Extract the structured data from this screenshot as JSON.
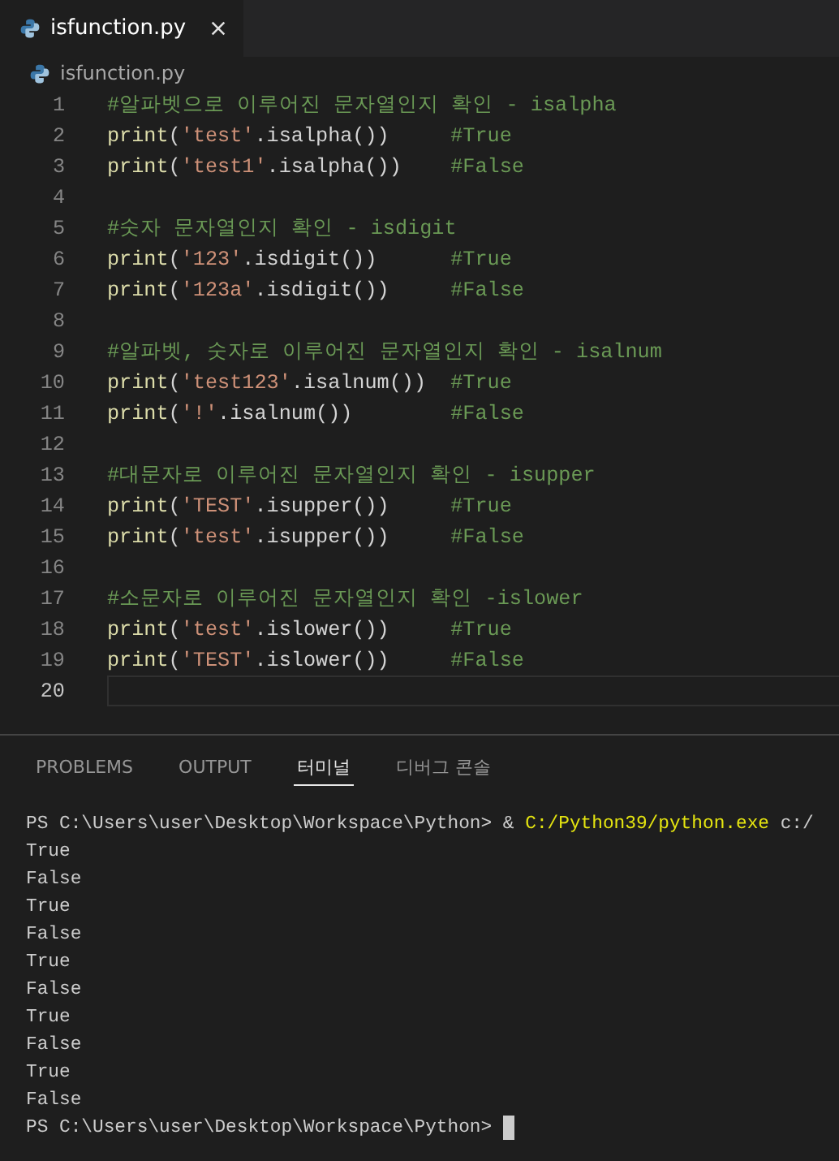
{
  "editor_tabs": [
    {
      "label": "isfunction.py",
      "selected": true
    }
  ],
  "breadcrumb": {
    "file": "isfunction.py"
  },
  "code": {
    "lines": [
      {
        "number": "1",
        "current": false,
        "tokens": [
          {
            "kind": "comment",
            "text": "#알파벳으로 이루어진 문자열인지 확인 - isalpha"
          }
        ]
      },
      {
        "number": "2",
        "current": false,
        "tokens": [
          {
            "kind": "func",
            "text": "print"
          },
          {
            "kind": "plain",
            "text": "("
          },
          {
            "kind": "string",
            "text": "'test'"
          },
          {
            "kind": "plain",
            "text": ".isalpha())"
          }
        ],
        "comment": "#True"
      },
      {
        "number": "3",
        "current": false,
        "tokens": [
          {
            "kind": "func",
            "text": "print"
          },
          {
            "kind": "plain",
            "text": "("
          },
          {
            "kind": "string",
            "text": "'test1'"
          },
          {
            "kind": "plain",
            "text": ".isalpha())"
          }
        ],
        "comment": "#False"
      },
      {
        "number": "4",
        "current": false
      },
      {
        "number": "5",
        "current": false,
        "tokens": [
          {
            "kind": "comment",
            "text": "#숫자 문자열인지 확인 - isdigit"
          }
        ]
      },
      {
        "number": "6",
        "current": false,
        "tokens": [
          {
            "kind": "func",
            "text": "print"
          },
          {
            "kind": "plain",
            "text": "("
          },
          {
            "kind": "string",
            "text": "'123'"
          },
          {
            "kind": "plain",
            "text": ".isdigit())"
          }
        ],
        "comment": "#True"
      },
      {
        "number": "7",
        "current": false,
        "tokens": [
          {
            "kind": "func",
            "text": "print"
          },
          {
            "kind": "plain",
            "text": "("
          },
          {
            "kind": "string",
            "text": "'123a'"
          },
          {
            "kind": "plain",
            "text": ".isdigit())"
          }
        ],
        "comment": "#False"
      },
      {
        "number": "8",
        "current": false
      },
      {
        "number": "9",
        "current": false,
        "tokens": [
          {
            "kind": "comment",
            "text": "#알파벳, 숫자로 이루어진 문자열인지 확인 - isalnum"
          }
        ]
      },
      {
        "number": "10",
        "current": false,
        "tokens": [
          {
            "kind": "func",
            "text": "print"
          },
          {
            "kind": "plain",
            "text": "("
          },
          {
            "kind": "string",
            "text": "'test123'"
          },
          {
            "kind": "plain",
            "text": ".isalnum())"
          }
        ],
        "comment": "#True"
      },
      {
        "number": "11",
        "current": false,
        "tokens": [
          {
            "kind": "func",
            "text": "print"
          },
          {
            "kind": "plain",
            "text": "("
          },
          {
            "kind": "string",
            "text": "'!'"
          },
          {
            "kind": "plain",
            "text": ".isalnum())"
          }
        ],
        "comment": "#False"
      },
      {
        "number": "12",
        "current": false
      },
      {
        "number": "13",
        "current": false,
        "tokens": [
          {
            "kind": "comment",
            "text": "#대문자로 이루어진 문자열인지 확인 - isupper"
          }
        ]
      },
      {
        "number": "14",
        "current": false,
        "tokens": [
          {
            "kind": "func",
            "text": "print"
          },
          {
            "kind": "plain",
            "text": "("
          },
          {
            "kind": "string",
            "text": "'TEST'"
          },
          {
            "kind": "plain",
            "text": ".isupper())"
          }
        ],
        "comment": "#True"
      },
      {
        "number": "15",
        "current": false,
        "tokens": [
          {
            "kind": "func",
            "text": "print"
          },
          {
            "kind": "plain",
            "text": "("
          },
          {
            "kind": "string",
            "text": "'test'"
          },
          {
            "kind": "plain",
            "text": ".isupper())"
          }
        ],
        "comment": "#False"
      },
      {
        "number": "16",
        "current": false
      },
      {
        "number": "17",
        "current": false,
        "tokens": [
          {
            "kind": "comment",
            "text": "#소문자로 이루어진 문자열인지 확인 -islower"
          }
        ]
      },
      {
        "number": "18",
        "current": false,
        "tokens": [
          {
            "kind": "func",
            "text": "print"
          },
          {
            "kind": "plain",
            "text": "("
          },
          {
            "kind": "string",
            "text": "'test'"
          },
          {
            "kind": "plain",
            "text": ".islower())"
          }
        ],
        "comment": "#True"
      },
      {
        "number": "19",
        "current": false,
        "tokens": [
          {
            "kind": "func",
            "text": "print"
          },
          {
            "kind": "plain",
            "text": "("
          },
          {
            "kind": "string",
            "text": "'TEST'"
          },
          {
            "kind": "plain",
            "text": ".islower())"
          }
        ],
        "comment": "#False"
      },
      {
        "number": "20",
        "current": true
      }
    ]
  },
  "panel_tabs": [
    {
      "label": "PROBLEMS",
      "selected": false
    },
    {
      "label": "OUTPUT",
      "selected": false
    },
    {
      "label": "터미널",
      "selected": true
    },
    {
      "label": "디버그 콘솔",
      "selected": false
    }
  ],
  "terminal": {
    "lines": [
      {
        "segments": [
          {
            "kind": "plain",
            "text": "PS C:\\Users\\user\\Desktop\\Workspace\\Python> & "
          },
          {
            "kind": "exe",
            "text": "C:/Python39/python.exe"
          },
          {
            "kind": "plain",
            "text": " c:/"
          }
        ]
      },
      {
        "segments": [
          {
            "kind": "plain",
            "text": "True"
          }
        ]
      },
      {
        "segments": [
          {
            "kind": "plain",
            "text": "False"
          }
        ]
      },
      {
        "segments": [
          {
            "kind": "plain",
            "text": "True"
          }
        ]
      },
      {
        "segments": [
          {
            "kind": "plain",
            "text": "False"
          }
        ]
      },
      {
        "segments": [
          {
            "kind": "plain",
            "text": "True"
          }
        ]
      },
      {
        "segments": [
          {
            "kind": "plain",
            "text": "False"
          }
        ]
      },
      {
        "segments": [
          {
            "kind": "plain",
            "text": "True"
          }
        ]
      },
      {
        "segments": [
          {
            "kind": "plain",
            "text": "False"
          }
        ]
      },
      {
        "segments": [
          {
            "kind": "plain",
            "text": "True"
          }
        ]
      },
      {
        "segments": [
          {
            "kind": "plain",
            "text": "False"
          }
        ]
      },
      {
        "segments": [
          {
            "kind": "plain",
            "text": "PS C:\\Users\\user\\Desktop\\Workspace\\Python> "
          }
        ],
        "cursor": true
      }
    ]
  }
}
